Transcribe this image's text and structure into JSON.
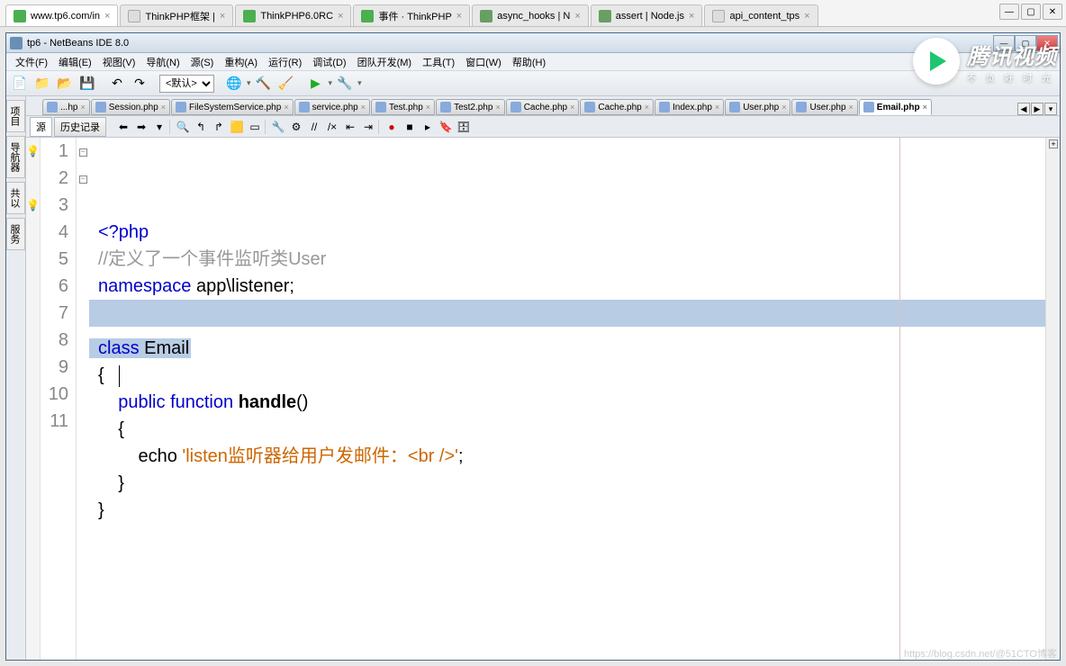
{
  "browser": {
    "tabs": [
      {
        "title": "www.tp6.com/in",
        "active": true,
        "icon": "green"
      },
      {
        "title": "ThinkPHP框架 |",
        "icon": "page"
      },
      {
        "title": "ThinkPHP6.0RC",
        "icon": "green"
      },
      {
        "title": "事件 · ThinkPHP",
        "icon": "green"
      },
      {
        "title": "async_hooks | N",
        "icon": "node"
      },
      {
        "title": "assert | Node.js",
        "icon": "node"
      },
      {
        "title": "api_content_tps",
        "icon": "page"
      }
    ],
    "win": {
      "min": "—",
      "max": "▢",
      "close": "✕"
    }
  },
  "ide": {
    "title": "tp6 - NetBeans IDE 8.0",
    "menus": [
      "文件(F)",
      "编辑(E)",
      "视图(V)",
      "导航(N)",
      "源(S)",
      "重构(A)",
      "运行(R)",
      "调试(D)",
      "团队开发(M)",
      "工具(T)",
      "窗口(W)",
      "帮助(H)"
    ],
    "config_default": "<默认>",
    "win": {
      "min": "—",
      "max": "▢",
      "close": "✕"
    }
  },
  "sidebar": [
    "项目",
    "导航器",
    "共以",
    "服务"
  ],
  "file_tabs": [
    "...hp",
    "Session.php",
    "FileSystemService.php",
    "service.php",
    "Test.php",
    "Test2.php",
    "Cache.php",
    "Cache.php",
    "Index.php",
    "User.php",
    "User.php",
    "Email.php"
  ],
  "active_tab_index": 11,
  "subtoolbar": {
    "source": "源",
    "history": "历史记录"
  },
  "code": {
    "lines": [
      {
        "n": 1,
        "glyph": "💡",
        "html": "<span class='kw'>&lt;?php</span>"
      },
      {
        "n": 2,
        "html": "<span class='comment'>//定义了一个事件监听类User</span>"
      },
      {
        "n": 3,
        "glyph": "💡",
        "html": "<span class='kw'>namespace</span> app\\listener;"
      },
      {
        "n": 4,
        "sel": true,
        "html": ""
      },
      {
        "n": 5,
        "sel": true,
        "selpartial": true,
        "html": "<span class='kw'>class</span> <span class='cls'>Email</span>"
      },
      {
        "n": 6,
        "fold": "-",
        "html": "{   <span class='cursor'></span>"
      },
      {
        "n": 7,
        "html": "    <span class='kw'>public</span> <span class='kw'>function</span> <span class='fn'>handle</span>()"
      },
      {
        "n": 8,
        "fold": "-",
        "html": "    {"
      },
      {
        "n": 9,
        "html": "        echo <span class='str'>'listen监听器给用户发邮件：&lt;br /&gt;'</span>;"
      },
      {
        "n": 10,
        "html": "    }"
      },
      {
        "n": 11,
        "html": "}"
      }
    ]
  },
  "logo": {
    "cn": "腾讯视频",
    "sub": "不 负 好 时 光"
  },
  "watermark": "https://blog.csdn.net/@51CTO博客"
}
